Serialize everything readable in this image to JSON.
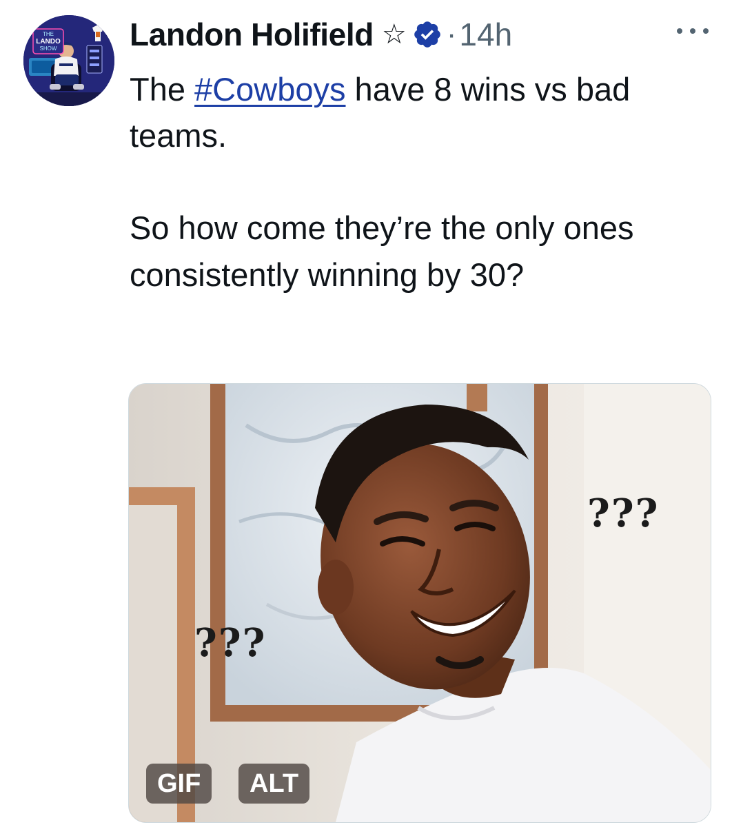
{
  "tweet": {
    "author": {
      "name": "Landon Holifield",
      "avatar_text": [
        "THE",
        "LANDO",
        "SHOW"
      ]
    },
    "separator": "·",
    "timestamp": "14h",
    "text": {
      "prefix": "The ",
      "hashtag": "#Cowboys",
      "suffix": " have 8 wins vs bad teams.",
      "paragraph2": "So how come they’re the only ones consistently winning by 30?"
    },
    "media": {
      "gif_badge": "GIF",
      "alt_badge": "ALT",
      "caption_right": "???",
      "caption_left": "???"
    }
  },
  "colors": {
    "text": "#0f1419",
    "secondary": "#536471",
    "link": "#1d3fa6",
    "verified": "#1d3fa6"
  },
  "icons": {
    "star": "star-icon",
    "verified": "verified-badge-icon",
    "more": "more-options-icon"
  }
}
